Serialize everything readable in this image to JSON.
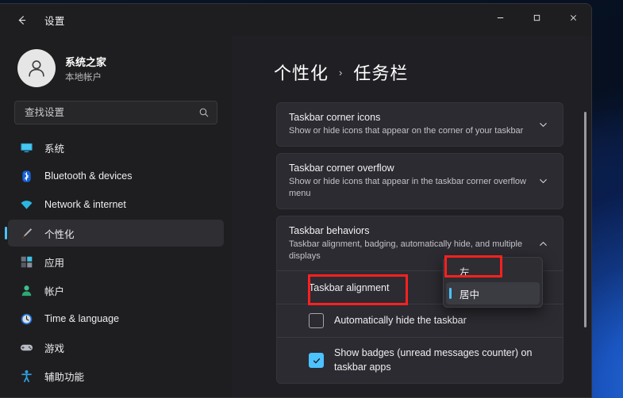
{
  "window": {
    "title": "设置",
    "back_icon": "back-arrow-icon",
    "controls": {
      "minimize": "–",
      "maximize": "▢",
      "close": "✕"
    }
  },
  "sidebar": {
    "account": {
      "name": "系统之家",
      "type": "本地帐户",
      "avatar_icon": "person-avatar-icon"
    },
    "search": {
      "placeholder": "查找设置",
      "value": "",
      "icon": "search-icon"
    },
    "items": [
      {
        "label": "系统",
        "icon": "monitor-icon",
        "selected": false
      },
      {
        "label": "Bluetooth & devices",
        "icon": "bluetooth-icon",
        "selected": false
      },
      {
        "label": "Network & internet",
        "icon": "wifi-icon",
        "selected": false
      },
      {
        "label": "个性化",
        "icon": "paintbrush-icon",
        "selected": true
      },
      {
        "label": "应用",
        "icon": "apps-grid-icon",
        "selected": false
      },
      {
        "label": "帐户",
        "icon": "account-person-icon",
        "selected": false
      },
      {
        "label": "Time & language",
        "icon": "clock-icon",
        "selected": false
      },
      {
        "label": "游戏",
        "icon": "gamepad-icon",
        "selected": false
      },
      {
        "label": "辅助功能",
        "icon": "accessibility-icon",
        "selected": false
      }
    ]
  },
  "main": {
    "breadcrumb": {
      "parent": "个性化",
      "separator": "›",
      "current": "任务栏"
    },
    "cards": [
      {
        "title": "Taskbar corner icons",
        "subtitle": "Show or hide icons that appear on the corner of your taskbar",
        "chevron": "chevron-down-icon",
        "expanded": false
      },
      {
        "title": "Taskbar corner overflow",
        "subtitle": "Show or hide icons that appear in the taskbar corner overflow menu",
        "chevron": "chevron-down-icon",
        "expanded": false
      },
      {
        "title": "Taskbar behaviors",
        "subtitle": "Taskbar alignment, badging, automatically hide, and multiple displays",
        "chevron": "chevron-up-icon",
        "expanded": true
      }
    ],
    "taskbar_alignment": {
      "label": "Taskbar alignment",
      "options": [
        "左",
        "居中"
      ],
      "selected": "居中"
    },
    "checkboxes": [
      {
        "label": "Automatically hide the taskbar",
        "checked": false
      },
      {
        "label": "Show badges (unread messages counter) on taskbar apps",
        "checked": true
      }
    ]
  },
  "annotations": {
    "accent_red": "#fc2020",
    "accent_blue": "#4cc2ff",
    "boxes": [
      "Taskbar alignment",
      "左"
    ]
  }
}
